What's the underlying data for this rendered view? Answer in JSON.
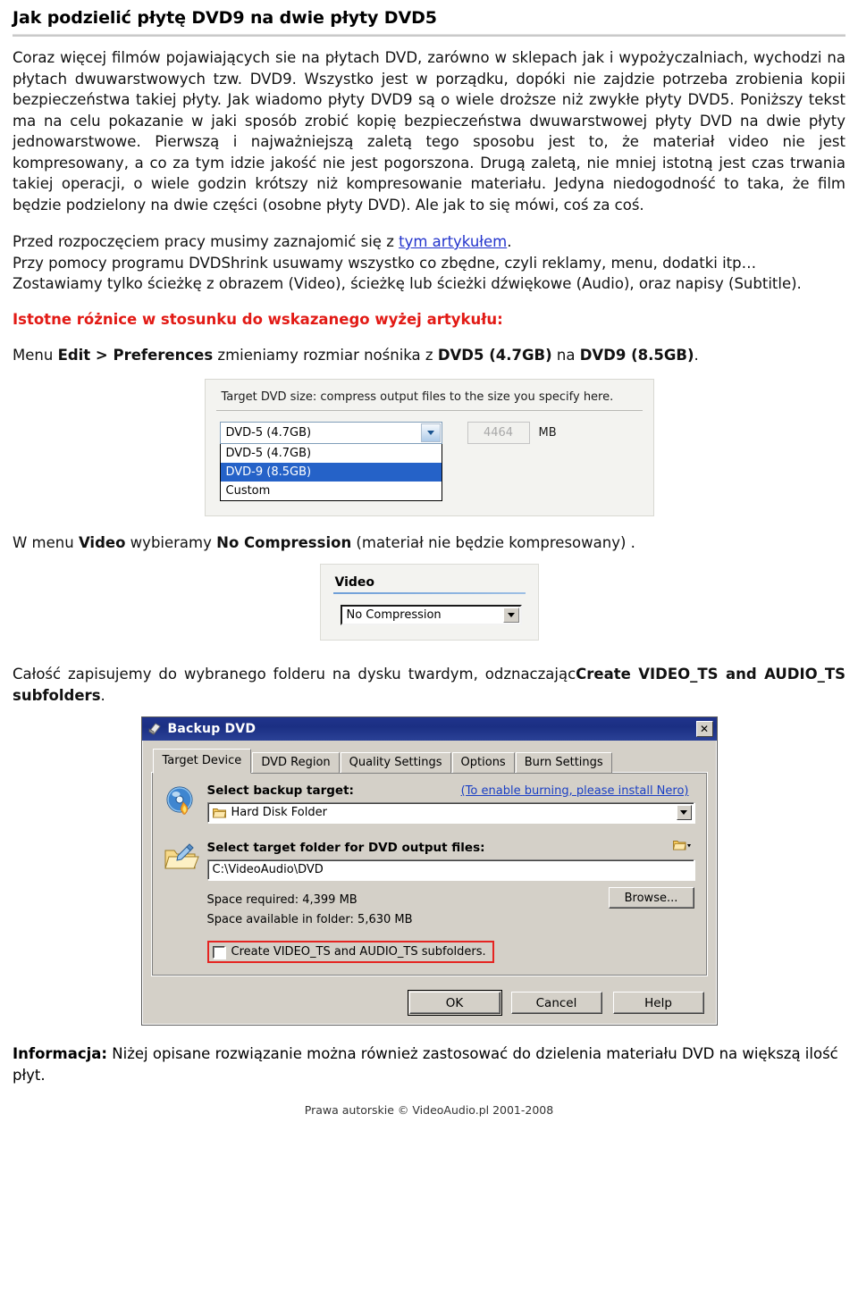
{
  "document": {
    "title": "Jak podzielić płytę DVD9 na dwie płyty DVD5"
  },
  "intro": {
    "paragraph": "Coraz więcej filmów pojawiających sie na płytach DVD, zarówno w sklepach jak i wypożyczalniach, wychodzi na płytach dwuwarstwowych tzw. DVD9. Wszystko jest w porządku, dopóki nie zajdzie potrzeba zrobienia kopii bezpieczeństwa takiej płyty. Jak wiadomo płyty DVD9 są o wiele droższe niż zwykłe płyty DVD5. Poniższy tekst ma na celu pokazanie w jaki sposób zrobić kopię bezpieczeństwa dwuwarstwowej płyty DVD na dwie płyty jednowarstwowe. Pierwszą i najważniejszą zaletą tego sposobu jest to, że materiał video nie jest kompresowany, a co za tym idzie jakość nie jest pogorszona. Drugą zaletą, nie mniej istotną jest czas trwania takiej operacji, o wiele godzin krótszy niż kompresowanie materiału. Jedyna niedogodność to taka, że film będzie podzielony na dwie części (osobne płyty DVD). Ale jak to się mówi, coś za coś."
  },
  "prep": {
    "line1_before": "Przed rozpoczęciem pracy musimy zaznajomić się z ",
    "line1_link": "tym artykułem",
    "line1_after": ".",
    "line2": "Przy pomocy programu DVDShrink usuwamy wszystko co zbędne, czyli reklamy, menu, dodatki itp…",
    "line3": "Zostawiamy tylko ścieżkę z obrazem (Video), ścieżkę lub ścieżki dźwiękowe (Audio), oraz napisy (Subtitle).",
    "red_heading": "Istotne różnice w stosunku do wskazanego wyżej artykułu:",
    "menu_line_1": "Menu ",
    "menu_line_bold1": "Edit > Preferences",
    "menu_line_2": " zmieniamy rozmiar nośnika z ",
    "menu_line_bold2": "DVD5 (4.7GB)",
    "menu_line_3": " na ",
    "menu_line_bold3": "DVD9 (8.5GB)",
    "menu_line_4": "."
  },
  "fig_target_size": {
    "caption": "Target DVD size: compress output files to the size you specify here.",
    "selected_value": "DVD-5 (4.7GB)",
    "options": [
      {
        "label": "DVD-5 (4.7GB)",
        "selected": false
      },
      {
        "label": "DVD-9 (8.5GB)",
        "selected": true
      },
      {
        "label": "Custom",
        "selected": false
      }
    ],
    "size_value": "4464",
    "size_unit": "MB"
  },
  "video_text": {
    "before": "W menu ",
    "bold1": "Video",
    "middle": " wybieramy ",
    "bold2": "No Compression",
    "after": " (materiał nie będzie kompresowany) ."
  },
  "fig_video": {
    "title": "Video",
    "selected_value": "No Compression"
  },
  "save_text": {
    "before": "Całość zapisujemy do wybranego folderu na dysku twardym, odznaczając",
    "bold": "Create VIDEO_TS and AUDIO_TS subfolders",
    "after": "."
  },
  "dialog": {
    "title": "Backup DVD",
    "close_label": "✕",
    "tabs": [
      {
        "label": "Target Device",
        "active": true
      },
      {
        "label": "DVD Region",
        "active": false
      },
      {
        "label": "Quality Settings",
        "active": false
      },
      {
        "label": "Options",
        "active": false
      },
      {
        "label": "Burn Settings",
        "active": false
      }
    ],
    "select_backup_target_label": "Select backup target:",
    "nero_link": "(To enable burning, please install Nero)",
    "backup_target_value": "Hard Disk Folder",
    "select_folder_label": "Select target folder for DVD output files:",
    "folder_path": "C:\\VideoAudio\\DVD",
    "space_required": "Space required:   4,399 MB",
    "space_available": "Space available in folder:   5,630 MB",
    "browse_label": "Browse...",
    "checkbox_label": "Create VIDEO_TS and AUDIO_TS subfolders.",
    "ok_label": "OK",
    "cancel_label": "Cancel",
    "help_label": "Help"
  },
  "info": {
    "bold": "Informacja:",
    "text": " Niżej opisane rozwiązanie można również zastosować do dzielenia materiału DVD na większą ilość płyt."
  },
  "footer": {
    "copyright": "Prawa autorskie © VideoAudio.pl 2001-2008"
  },
  "colors": {
    "red_heading": "#e21a15",
    "link": "#2233cc",
    "dialog_titlebar": "#20348c",
    "highlight_box": "#e52421",
    "list_selection": "#2562c8"
  }
}
